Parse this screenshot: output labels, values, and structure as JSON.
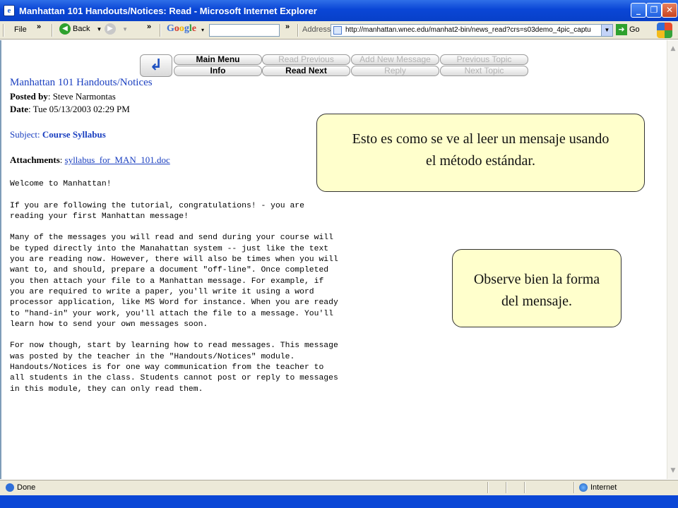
{
  "window": {
    "title": "Manhattan 101 Handouts/Notices: Read - Microsoft Internet Explorer",
    "app_icon": "ie-icon",
    "controls": [
      "minimize",
      "maximize",
      "close"
    ]
  },
  "toolbar": {
    "file_label": "File",
    "back_label": "Back",
    "google_label": "Google",
    "address_label": "Address",
    "address_url": "http://manhattan.wnec.edu/manhat2-bin/news_read?crs=s03demo_4pic_captu",
    "go_label": "Go"
  },
  "nav": {
    "main_menu": "Main Menu",
    "read_previous": "Read Previous",
    "add_new_message": "Add New Message",
    "previous_topic": "Previous Topic",
    "info": "Info",
    "read_next": "Read Next",
    "reply": "Reply",
    "next_topic": "Next Topic"
  },
  "message": {
    "heading": "Manhattan 101 Handouts/Notices",
    "posted_by_label": "Posted by",
    "posted_by": "Steve Narmontas",
    "date_label": "Date",
    "date": "Tue 05/13/2003 02:29 PM",
    "subject_label": "Subject:",
    "subject": "Course Syllabus",
    "attachments_label": "Attachments",
    "attachment": "syllabus_for_MAN_101.doc",
    "body": "Welcome to Manhattan!\n\nIf you are following the tutorial, congratulations! - you are\nreading your first Manhattan message!\n\nMany of the messages you will read and send during your course will\nbe typed directly into the Manahattan system -- just like the text\nyou are reading now. However, there will also be times when you will\nwant to, and should, prepare a document \"off-line\". Once completed\nyou then attach your file to a Manhattan message. For example, if\nyou are required to write a paper, you'll write it using a word\nprocessor application, like MS Word for instance. When you are ready\nto \"hand-in\" your work, you'll attach the file to a message. You'll\nlearn how to send your own messages soon.\n\nFor now though, start by learning how to read messages. This message\nwas posted by the teacher in the \"Handouts/Notices\" module.\nHandouts/Notices is for one way communication from the teacher to\nall students in the class. Students cannot post or reply to messages\nin this module, they can only read them."
  },
  "callouts": {
    "first": "Esto es como se ve al leer un mensaje usando el método estándar.",
    "second": "Observe bien la forma del mensaje."
  },
  "status": {
    "left": "Done",
    "zone": "Internet"
  }
}
